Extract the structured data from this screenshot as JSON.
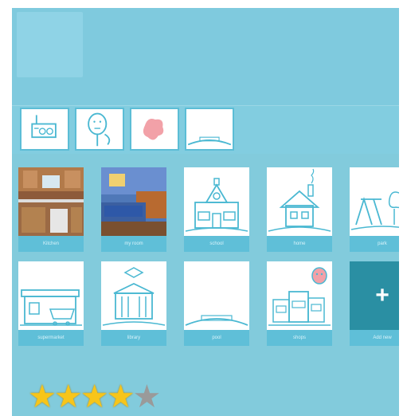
{
  "tiles_row1": [
    {
      "label": "Kitchen",
      "icon": "kitchen-photo"
    },
    {
      "label": "my room",
      "icon": "bedroom-photo"
    },
    {
      "label": "school",
      "icon": "school-icon"
    },
    {
      "label": "home",
      "icon": "house-icon"
    },
    {
      "label": "park",
      "icon": "park-icon"
    }
  ],
  "tiles_row2": [
    {
      "label": "supermarket",
      "icon": "store-icon"
    },
    {
      "label": "library",
      "icon": "library-icon"
    },
    {
      "label": "pool",
      "icon": "pool-icon"
    },
    {
      "label": "shops",
      "icon": "shops-icon"
    },
    {
      "label": "Add new",
      "icon": "plus-icon"
    }
  ],
  "add_symbol": "+",
  "rating": {
    "value": 4,
    "max": 5,
    "glyph": "★"
  },
  "colors": {
    "background": "#7ecbde",
    "tile_label": "#5fbfd8",
    "add_tile": "#2a8fa3",
    "star": "#f7c51a"
  }
}
